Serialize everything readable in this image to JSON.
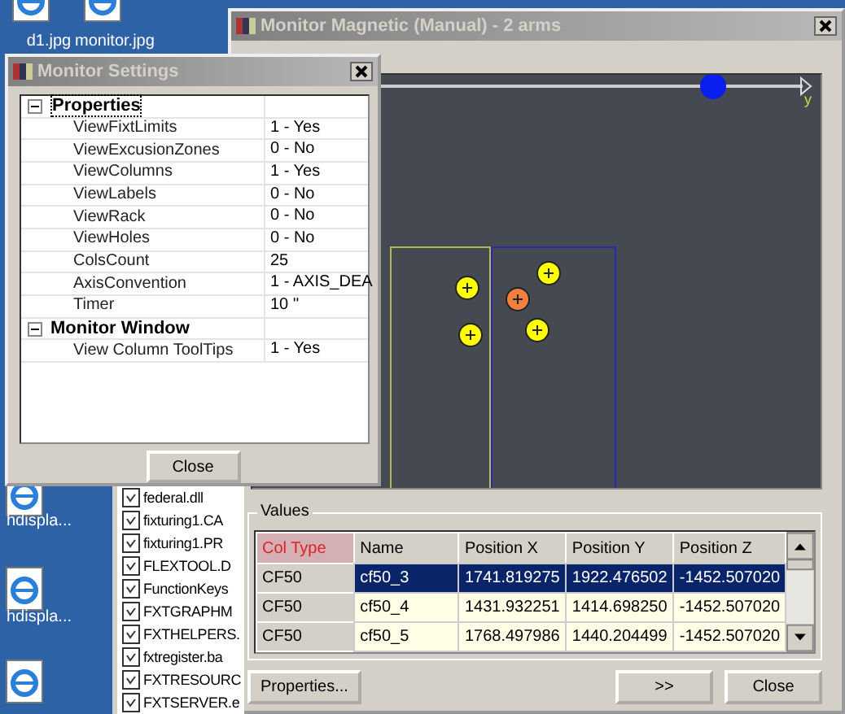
{
  "desktop_icons": [
    {
      "label": "d1.jpg"
    },
    {
      "label": "monitor.jpg"
    },
    {
      "label": "hdispla..."
    },
    {
      "label": "hdispla..."
    }
  ],
  "file_list": [
    "federal.dll",
    "fixturing1.CA",
    "fixturing1.PR",
    "FLEXTOOL.D",
    "FunctionKeys",
    "FXTGRAPHM",
    "FXTHELPERS.",
    "fxtregister.ba",
    "FXTRESOURC",
    "FXTSERVER.e"
  ],
  "main_window": {
    "title": "Monitor Magnetic (Manual) - 2 arms",
    "axis_label": "y",
    "values_group": {
      "title": "Values",
      "columns": [
        "Col Type",
        "Name",
        "Position X",
        "Position Y",
        "Position Z"
      ],
      "rows": [
        {
          "cells": [
            "CF50",
            "cf50_3",
            "1741.819275",
            "1922.476502",
            "-1452.507020"
          ],
          "selected": true
        },
        {
          "cells": [
            "CF50",
            "cf50_4",
            "1431.932251",
            "1414.698250",
            "-1452.507020"
          ],
          "selected": false
        },
        {
          "cells": [
            "CF50",
            "cf50_5",
            "1768.497986",
            "1440.204499",
            "-1452.507020"
          ],
          "selected": false
        }
      ]
    },
    "buttons": [
      "Properties...",
      ">>",
      "Close"
    ]
  },
  "settings_dialog": {
    "title": "Monitor Settings",
    "categories": [
      {
        "name": "Properties",
        "expanded": true,
        "children": [
          {
            "name": "ViewFixtLimits",
            "value": "1 - Yes"
          },
          {
            "name": "ViewExcusionZones",
            "value": "0 - No"
          },
          {
            "name": "ViewColumns",
            "value": "1 - Yes"
          },
          {
            "name": "ViewLabels",
            "value": "0 - No"
          },
          {
            "name": "ViewRack",
            "value": "0 - No"
          },
          {
            "name": "ViewHoles",
            "value": "0 - No"
          },
          {
            "name": "ColsCount",
            "value": "25"
          },
          {
            "name": "AxisConvention",
            "value": "1 - AXIS_DEA"
          },
          {
            "name": "Timer",
            "value": "10 ''"
          }
        ]
      },
      {
        "name": "Monitor Window",
        "expanded": true,
        "children": [
          {
            "name": "View Column ToolTips",
            "value": "1 - Yes"
          }
        ]
      }
    ],
    "button": "Close"
  }
}
